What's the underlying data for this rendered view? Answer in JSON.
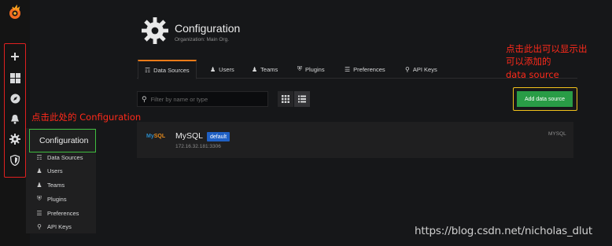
{
  "sidebar": {
    "icons": [
      "grafana-logo-icon",
      "plus-icon",
      "dashboards-icon",
      "explore-icon",
      "bell-icon",
      "gear-icon",
      "shield-icon"
    ]
  },
  "submenu": {
    "header": "Configuration",
    "items": [
      {
        "label": "Data Sources",
        "icon": "database-icon"
      },
      {
        "label": "Users",
        "icon": "user-icon"
      },
      {
        "label": "Teams",
        "icon": "users-icon"
      },
      {
        "label": "Plugins",
        "icon": "plug-icon"
      },
      {
        "label": "Preferences",
        "icon": "sliders-icon"
      },
      {
        "label": "API Keys",
        "icon": "key-icon"
      }
    ]
  },
  "header": {
    "title": "Configuration",
    "subtitle": "Organization: Main Org."
  },
  "tabs": [
    {
      "label": "Data Sources",
      "active": true
    },
    {
      "label": "Users",
      "active": false
    },
    {
      "label": "Teams",
      "active": false
    },
    {
      "label": "Plugins",
      "active": false
    },
    {
      "label": "Preferences",
      "active": false
    },
    {
      "label": "API Keys",
      "active": false
    }
  ],
  "search": {
    "placeholder": "Filter by name or type"
  },
  "add_button": "Add data source",
  "datasource": {
    "logo_text_a": "My",
    "logo_text_b": "SQL",
    "name": "MySQL",
    "badge": "default",
    "url": "172.16.32.181:3306",
    "type": "MYSQL"
  },
  "annotations": {
    "left": "点击此处的 Configuration",
    "right_line1": "点击此出可以显示出",
    "right_line2": "可以添加的",
    "right_line3": "data source"
  },
  "watermark": "https://blog.csdn.net/nicholas_dlut",
  "colors": {
    "accent_orange": "#eb7b18",
    "add_green": "#299c46",
    "badge_blue": "#1f60c4",
    "annotation_red": "#ff2a1a",
    "highlight_green": "#3fbd3f",
    "highlight_yellow": "#f2c21b"
  }
}
